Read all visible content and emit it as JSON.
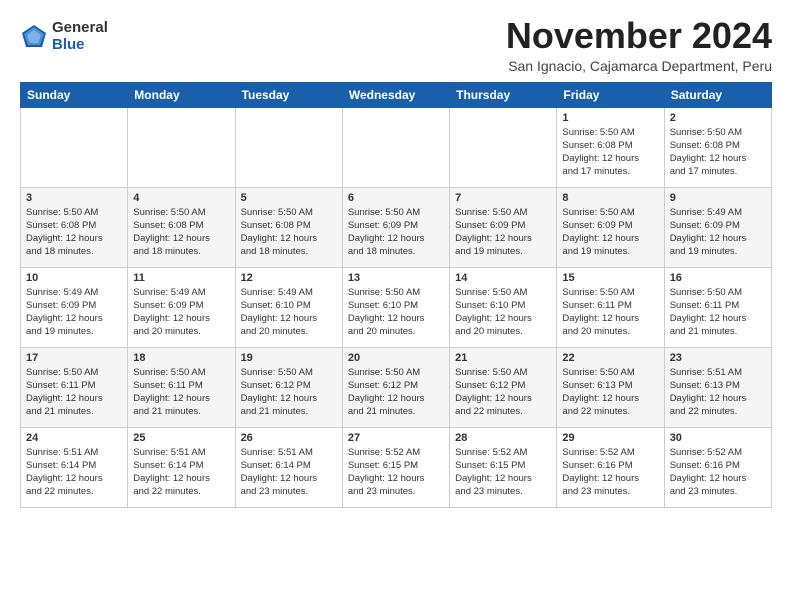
{
  "logo": {
    "general": "General",
    "blue": "Blue"
  },
  "title": "November 2024",
  "subtitle": "San Ignacio, Cajamarca Department, Peru",
  "days_of_week": [
    "Sunday",
    "Monday",
    "Tuesday",
    "Wednesday",
    "Thursday",
    "Friday",
    "Saturday"
  ],
  "weeks": [
    [
      {
        "day": "",
        "info": ""
      },
      {
        "day": "",
        "info": ""
      },
      {
        "day": "",
        "info": ""
      },
      {
        "day": "",
        "info": ""
      },
      {
        "day": "",
        "info": ""
      },
      {
        "day": "1",
        "info": "Sunrise: 5:50 AM\nSunset: 6:08 PM\nDaylight: 12 hours\nand 17 minutes."
      },
      {
        "day": "2",
        "info": "Sunrise: 5:50 AM\nSunset: 6:08 PM\nDaylight: 12 hours\nand 17 minutes."
      }
    ],
    [
      {
        "day": "3",
        "info": "Sunrise: 5:50 AM\nSunset: 6:08 PM\nDaylight: 12 hours\nand 18 minutes."
      },
      {
        "day": "4",
        "info": "Sunrise: 5:50 AM\nSunset: 6:08 PM\nDaylight: 12 hours\nand 18 minutes."
      },
      {
        "day": "5",
        "info": "Sunrise: 5:50 AM\nSunset: 6:08 PM\nDaylight: 12 hours\nand 18 minutes."
      },
      {
        "day": "6",
        "info": "Sunrise: 5:50 AM\nSunset: 6:09 PM\nDaylight: 12 hours\nand 18 minutes."
      },
      {
        "day": "7",
        "info": "Sunrise: 5:50 AM\nSunset: 6:09 PM\nDaylight: 12 hours\nand 19 minutes."
      },
      {
        "day": "8",
        "info": "Sunrise: 5:50 AM\nSunset: 6:09 PM\nDaylight: 12 hours\nand 19 minutes."
      },
      {
        "day": "9",
        "info": "Sunrise: 5:49 AM\nSunset: 6:09 PM\nDaylight: 12 hours\nand 19 minutes."
      }
    ],
    [
      {
        "day": "10",
        "info": "Sunrise: 5:49 AM\nSunset: 6:09 PM\nDaylight: 12 hours\nand 19 minutes."
      },
      {
        "day": "11",
        "info": "Sunrise: 5:49 AM\nSunset: 6:09 PM\nDaylight: 12 hours\nand 20 minutes."
      },
      {
        "day": "12",
        "info": "Sunrise: 5:49 AM\nSunset: 6:10 PM\nDaylight: 12 hours\nand 20 minutes."
      },
      {
        "day": "13",
        "info": "Sunrise: 5:50 AM\nSunset: 6:10 PM\nDaylight: 12 hours\nand 20 minutes."
      },
      {
        "day": "14",
        "info": "Sunrise: 5:50 AM\nSunset: 6:10 PM\nDaylight: 12 hours\nand 20 minutes."
      },
      {
        "day": "15",
        "info": "Sunrise: 5:50 AM\nSunset: 6:11 PM\nDaylight: 12 hours\nand 20 minutes."
      },
      {
        "day": "16",
        "info": "Sunrise: 5:50 AM\nSunset: 6:11 PM\nDaylight: 12 hours\nand 21 minutes."
      }
    ],
    [
      {
        "day": "17",
        "info": "Sunrise: 5:50 AM\nSunset: 6:11 PM\nDaylight: 12 hours\nand 21 minutes."
      },
      {
        "day": "18",
        "info": "Sunrise: 5:50 AM\nSunset: 6:11 PM\nDaylight: 12 hours\nand 21 minutes."
      },
      {
        "day": "19",
        "info": "Sunrise: 5:50 AM\nSunset: 6:12 PM\nDaylight: 12 hours\nand 21 minutes."
      },
      {
        "day": "20",
        "info": "Sunrise: 5:50 AM\nSunset: 6:12 PM\nDaylight: 12 hours\nand 21 minutes."
      },
      {
        "day": "21",
        "info": "Sunrise: 5:50 AM\nSunset: 6:12 PM\nDaylight: 12 hours\nand 22 minutes."
      },
      {
        "day": "22",
        "info": "Sunrise: 5:50 AM\nSunset: 6:13 PM\nDaylight: 12 hours\nand 22 minutes."
      },
      {
        "day": "23",
        "info": "Sunrise: 5:51 AM\nSunset: 6:13 PM\nDaylight: 12 hours\nand 22 minutes."
      }
    ],
    [
      {
        "day": "24",
        "info": "Sunrise: 5:51 AM\nSunset: 6:14 PM\nDaylight: 12 hours\nand 22 minutes."
      },
      {
        "day": "25",
        "info": "Sunrise: 5:51 AM\nSunset: 6:14 PM\nDaylight: 12 hours\nand 22 minutes."
      },
      {
        "day": "26",
        "info": "Sunrise: 5:51 AM\nSunset: 6:14 PM\nDaylight: 12 hours\nand 23 minutes."
      },
      {
        "day": "27",
        "info": "Sunrise: 5:52 AM\nSunset: 6:15 PM\nDaylight: 12 hours\nand 23 minutes."
      },
      {
        "day": "28",
        "info": "Sunrise: 5:52 AM\nSunset: 6:15 PM\nDaylight: 12 hours\nand 23 minutes."
      },
      {
        "day": "29",
        "info": "Sunrise: 5:52 AM\nSunset: 6:16 PM\nDaylight: 12 hours\nand 23 minutes."
      },
      {
        "day": "30",
        "info": "Sunrise: 5:52 AM\nSunset: 6:16 PM\nDaylight: 12 hours\nand 23 minutes."
      }
    ]
  ]
}
